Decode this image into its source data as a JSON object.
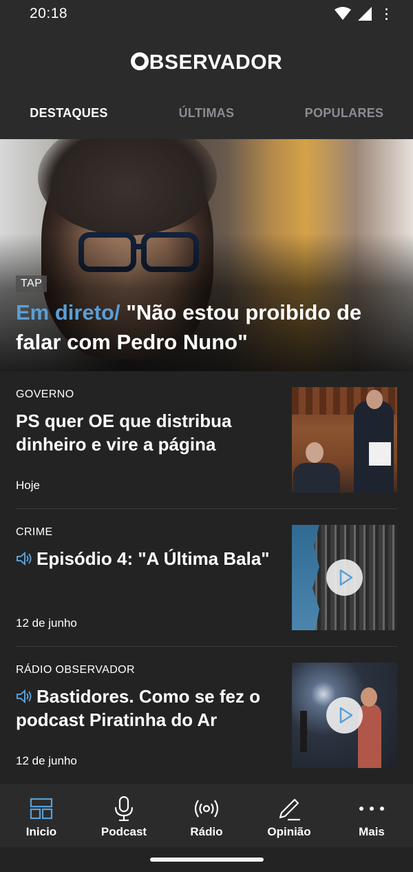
{
  "status": {
    "time": "20:18"
  },
  "header": {
    "logo": "BSERVADOR"
  },
  "tabs": [
    {
      "label": "DESTAQUES",
      "active": true
    },
    {
      "label": "ÚLTIMAS",
      "active": false
    },
    {
      "label": "POPULARES",
      "active": false
    }
  ],
  "hero": {
    "tag": "TAP",
    "live_label": "Em direto/",
    "title": " \"Não estou proibido de falar com Pedro Nuno\""
  },
  "articles": [
    {
      "category": "GOVERNO",
      "title": "PS quer OE que distribua dinheiro e vire a página",
      "date": "Hoje",
      "audio": false,
      "play": false
    },
    {
      "category": "CRIME",
      "title": "Episódio 4: \"A Última Bala\"",
      "date": "12 de junho",
      "audio": true,
      "play": true
    },
    {
      "category": "RÁDIO OBSERVADOR",
      "title": "Bastidores. Como se fez o podcast Piratinha do Ar",
      "date": "12 de junho",
      "audio": true,
      "play": true
    }
  ],
  "nav": [
    {
      "label": "Inicio",
      "icon": "home-grid-icon"
    },
    {
      "label": "Podcast",
      "icon": "microphone-icon"
    },
    {
      "label": "Rádio",
      "icon": "radio-broadcast-icon"
    },
    {
      "label": "Opinião",
      "icon": "pencil-icon"
    },
    {
      "label": "Mais",
      "icon": "more-dots-icon"
    }
  ],
  "colors": {
    "accent": "#5a9fd6",
    "background": "#232323",
    "bar": "#2b2b2b"
  }
}
